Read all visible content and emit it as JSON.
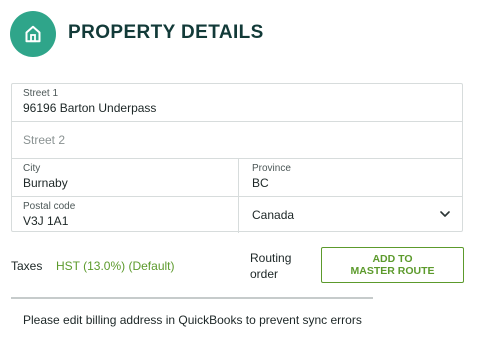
{
  "header": {
    "icon": "home-icon",
    "title": "PROPERTY DETAILS",
    "accent_color": "#2fa58a"
  },
  "address": {
    "street1": {
      "label": "Street 1",
      "value": "96196 Barton Underpass"
    },
    "street2": {
      "placeholder": "Street 2"
    },
    "city": {
      "label": "City",
      "value": "Burnaby"
    },
    "province": {
      "label": "Province",
      "value": "BC"
    },
    "postal": {
      "label": "Postal code",
      "value": "V3J 1A1"
    },
    "country": {
      "value": "Canada",
      "icon": "chevron-down-icon"
    }
  },
  "taxes": {
    "label": "Taxes",
    "value": "HST (13.0%) (Default)",
    "value_color": "#5c9a2c"
  },
  "routing": {
    "label": "Routing order",
    "button_label": "ADD TO MASTER ROUTE"
  },
  "note": "Please edit billing address in QuickBooks to prevent sync errors"
}
